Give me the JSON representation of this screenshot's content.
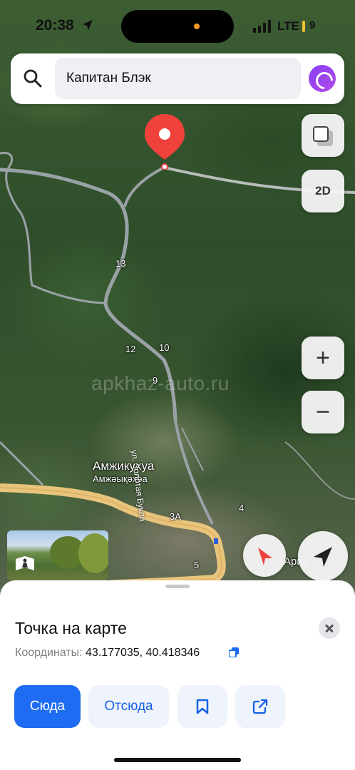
{
  "status_bar": {
    "time": "20:38",
    "network": "LTE",
    "battery": "9",
    "battery_color": "#f2c230",
    "icons": [
      "location-arrow-icon",
      "signal-icon",
      "battery-icon"
    ]
  },
  "search": {
    "value": "Капитан Блэк",
    "icon": "search-icon",
    "assistant_icon": "alice-icon"
  },
  "map": {
    "watermark": "apkhaz-auto.ru",
    "place_name": "Амжикухуа",
    "place_name_alt": "Амжәықәхәа",
    "street_name": "ул. Золотая Букла",
    "house_numbers": [
      "13",
      "12",
      "10",
      "9",
      "4",
      "3A",
      "5"
    ],
    "partial_label": "Арик",
    "controls": {
      "layers_icon": "layers-icon",
      "view_mode": "2D",
      "zoom_in": "+",
      "zoom_out": "−",
      "compass_icon": "compass-icon",
      "my_location_icon": "navigation-arrow-icon"
    },
    "pin_color": "#f0413b",
    "accent_color": "#1e6cf2"
  },
  "sheet": {
    "title": "Точка на карте",
    "coords_label": "Координаты:",
    "coords_value": "43.177035, 40.418346",
    "actions": {
      "here": "Сюда",
      "from": "Отсюда",
      "save_icon": "bookmark-icon",
      "share_icon": "share-icon"
    }
  }
}
